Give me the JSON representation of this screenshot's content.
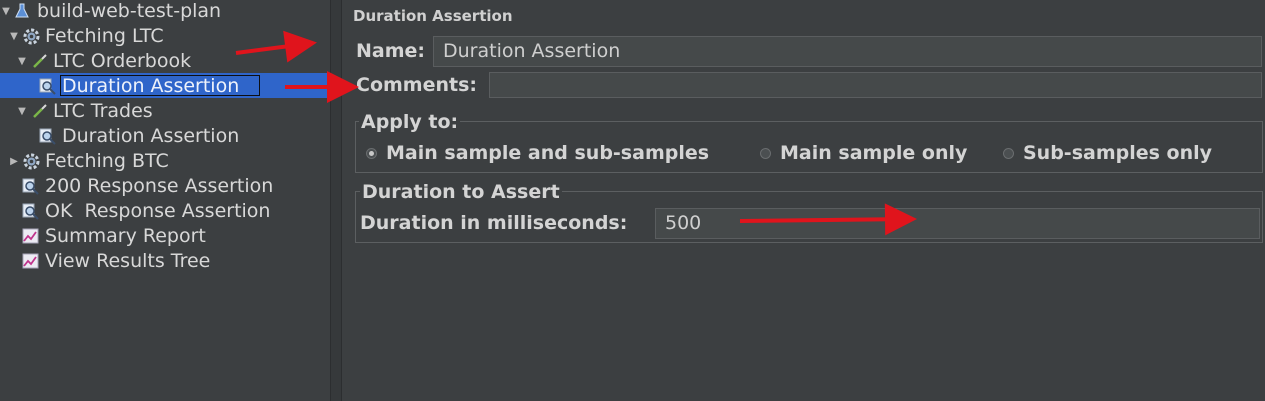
{
  "tree": {
    "items": [
      {
        "label": "build-web-test-plan",
        "icon": "flask-icon",
        "expanded": true
      },
      {
        "label": "Fetching LTC",
        "icon": "gear-icon",
        "expanded": true
      },
      {
        "label": "LTC Orderbook",
        "icon": "pipette-icon",
        "expanded": true
      },
      {
        "label": "Duration Assertion",
        "icon": "magnifier-icon",
        "selected": true
      },
      {
        "label": "LTC Trades",
        "icon": "pipette-icon",
        "expanded": true
      },
      {
        "label": "Duration Assertion",
        "icon": "magnifier-icon"
      },
      {
        "label": "Fetching BTC",
        "icon": "gear-icon",
        "expanded": false
      },
      {
        "label": "200 Response Assertion",
        "icon": "magnifier-icon"
      },
      {
        "label": "OK  Response Assertion",
        "icon": "magnifier-icon"
      },
      {
        "label": "Summary Report",
        "icon": "graph-icon"
      },
      {
        "label": "View Results Tree",
        "icon": "graph-icon"
      }
    ]
  },
  "panel": {
    "title": "Duration Assertion",
    "name_label": "Name:",
    "name_value": "Duration Assertion",
    "comments_label": "Comments:",
    "comments_value": "",
    "apply_to": {
      "title": "Apply to:",
      "options": [
        {
          "label": "Main sample and sub-samples",
          "selected": true
        },
        {
          "label": "Main sample only",
          "selected": false
        },
        {
          "label": "Sub-samples only",
          "selected": false
        }
      ]
    },
    "duration": {
      "title": "Duration to Assert",
      "label": "Duration in milliseconds:",
      "value": "500"
    }
  },
  "colors": {
    "background": "#3c3f41",
    "selection": "#2f65ca",
    "annotation_arrow": "#e0141c"
  }
}
